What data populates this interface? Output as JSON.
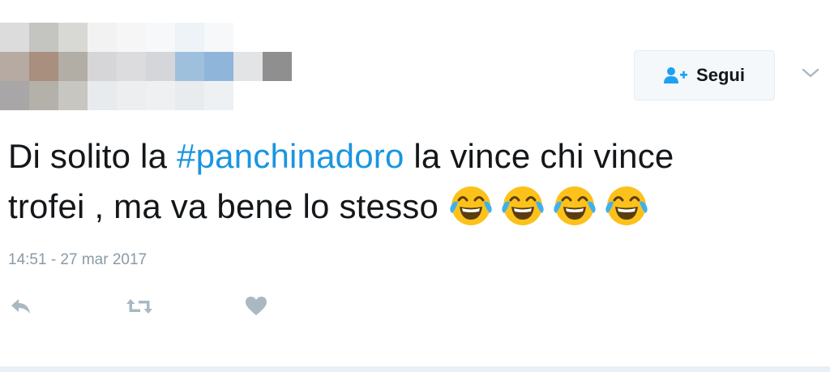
{
  "header": {
    "follow_label": "Segui",
    "follow_icon": "add-user-icon",
    "menu_icon": "chevron-down-icon"
  },
  "tweet": {
    "text_before": "Di solito la ",
    "hashtag": "#panchinadoro",
    "text_after_line1": " la vince chi vince",
    "text_line2": "trofei , ma va bene lo stesso",
    "emoji_icon": "face-with-tears-of-joy-icon",
    "emoji_count": 4,
    "timestamp": "14:51 - 27 mar 2017"
  },
  "actions": {
    "reply_icon": "reply-icon",
    "retweet_icon": "retweet-icon",
    "like_icon": "heart-icon"
  },
  "colors": {
    "hashtag": "#1b95e0",
    "text": "#14171a",
    "muted": "#8a9aa6",
    "icon": "#aab8c2",
    "follow_icon": "#1da1f2"
  }
}
